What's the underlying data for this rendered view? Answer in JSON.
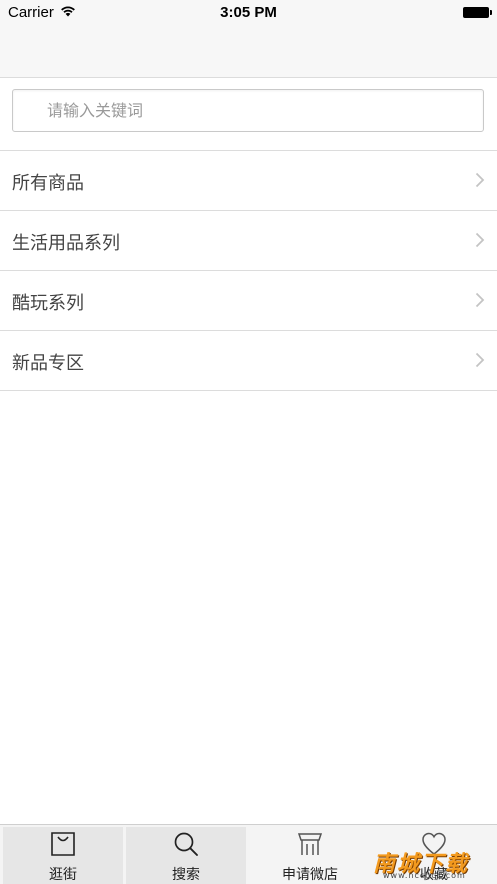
{
  "status_bar": {
    "carrier": "Carrier",
    "time": "3:05 PM"
  },
  "search": {
    "placeholder": "请输入关键词",
    "value": ""
  },
  "categories": [
    {
      "label": "所有商品"
    },
    {
      "label": "生活用品系列"
    },
    {
      "label": "酷玩系列"
    },
    {
      "label": "新品专区"
    }
  ],
  "tabs": [
    {
      "label": "逛街",
      "icon": "shopping-bag-icon",
      "active": true
    },
    {
      "label": "搜索",
      "icon": "search-icon",
      "active": true
    },
    {
      "label": "申请微店",
      "icon": "shop-awning-icon",
      "active": false
    },
    {
      "label": "收藏",
      "icon": "heart-icon",
      "active": false
    }
  ],
  "watermark": {
    "text": "南城下载",
    "sub": "www.nccgcc.com"
  },
  "colors": {
    "separator": "#dcdcdc",
    "tab_active": "#e6e6e6",
    "watermark": "#f39a1e"
  }
}
